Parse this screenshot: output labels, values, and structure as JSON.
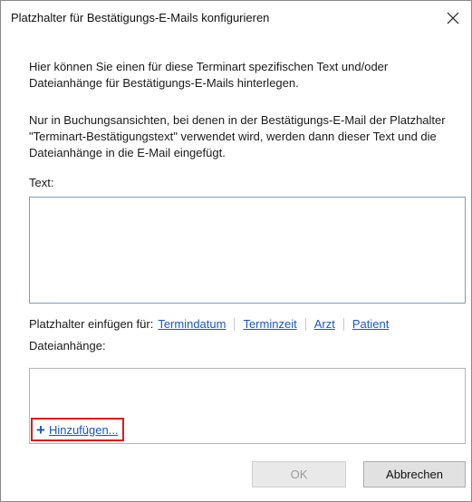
{
  "window": {
    "title": "Platzhalter für Bestätigungs-E-Mails konfigurieren",
    "close_icon": "close-icon"
  },
  "intro": {
    "paragraph1": "Hier können Sie einen für diese Terminart spezifischen Text und/oder Dateianhänge für Bestätigungs-E-Mails hinterlegen.",
    "paragraph2": "Nur in Buchungsansichten, bei denen in der Bestätigungs-E-Mail der Platzhalter \"Terminart-Bestätigungstext\" verwendet wird, werden dann dieser Text und die Dateianhänge in die E-Mail eingefügt."
  },
  "text_field": {
    "label": "Text:",
    "value": ""
  },
  "placeholders": {
    "label": "Platzhalter einfügen für:",
    "links": [
      "Termindatum",
      "Terminzeit",
      "Arzt",
      "Patient"
    ]
  },
  "attachments": {
    "label": "Dateianhänge:",
    "add_label": "Hinzufügen...",
    "add_icon": "plus-icon"
  },
  "buttons": {
    "ok": "OK",
    "cancel": "Abbrechen"
  },
  "colors": {
    "link": "#1a56c8",
    "highlight": "#e0191e",
    "input_border": "#7a9cc6"
  }
}
